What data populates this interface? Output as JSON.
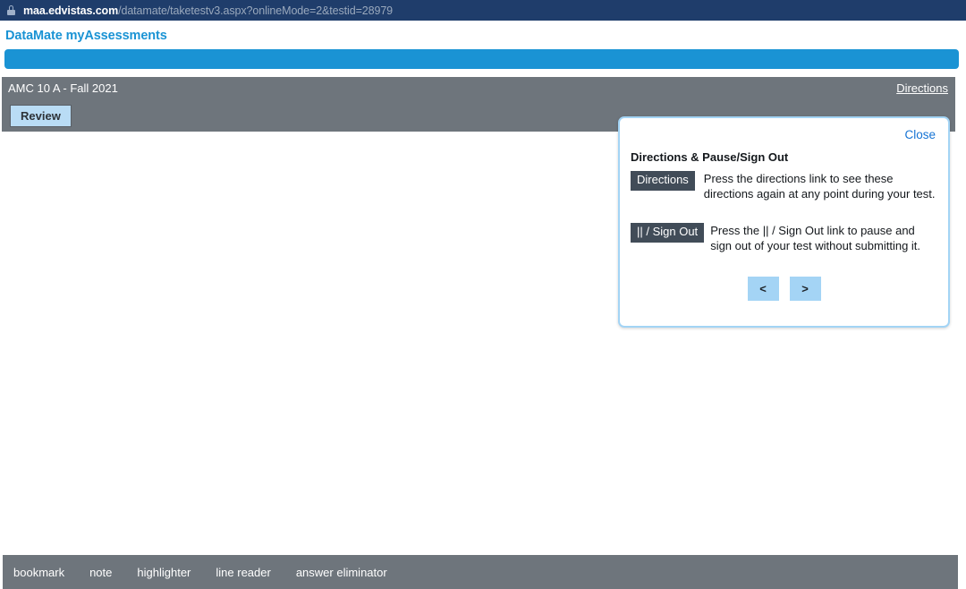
{
  "browser": {
    "lock_icon": "lock-icon",
    "url_host": "maa.edvistas.com",
    "url_path": "/datamate/taketestv3.aspx?onlineMode=2&testid=28979"
  },
  "header": {
    "brand": "DataMate myAssessments"
  },
  "test": {
    "title": "AMC 10 A - Fall 2021",
    "directions_link": "Directions",
    "review_button": "Review"
  },
  "modal": {
    "close_label": "Close",
    "title": "Directions & Pause/Sign Out",
    "rows": [
      {
        "badge": "Directions",
        "text": "Press the directions link to see these directions again at any point during your test."
      },
      {
        "badge": "|| / Sign Out",
        "text": "Press the || / Sign Out link to pause and sign out of your test without submitting it."
      }
    ],
    "prev_button": "<",
    "next_button": ">"
  },
  "toolbar": {
    "items": [
      {
        "label": "bookmark"
      },
      {
        "label": "note"
      },
      {
        "label": "highlighter"
      },
      {
        "label": "line reader"
      },
      {
        "label": "answer eliminator"
      }
    ]
  },
  "colors": {
    "url_bar": "#1f3d6b",
    "brand_blue": "#1a93d4",
    "gray_bar": "#6e757c",
    "light_blue": "#a4d4f5",
    "badge_dark": "#414c58",
    "link_blue": "#1573d4"
  }
}
